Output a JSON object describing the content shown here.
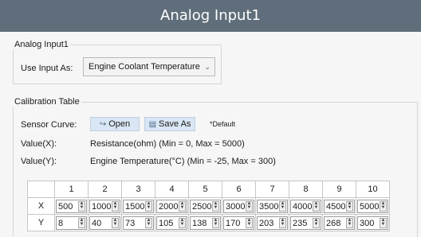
{
  "window": {
    "title": "Analog Input1"
  },
  "input_group": {
    "legend": "Analog Input1",
    "use_label": "Use Input As:",
    "use_value": "Engine Coolant Temperature"
  },
  "calibration": {
    "legend": "Calibration Table",
    "sensor_curve_label": "Sensor Curve:",
    "open_label": "Open",
    "save_label": "Save As",
    "default_note": "*Default",
    "value_x_label": "Value(X):",
    "value_x_text": "Resistance(ohm) (Min = 0, Max = 5000)",
    "value_y_label": "Value(Y):",
    "value_y_text": "Engine Temperature(°C) (Min = -25, Max = 300)",
    "columns": [
      "1",
      "2",
      "3",
      "4",
      "5",
      "6",
      "7",
      "8",
      "9",
      "10"
    ],
    "row_x_label": "X",
    "row_y_label": "Y",
    "x": [
      "500",
      "1000",
      "1500",
      "2000",
      "2500",
      "3000",
      "3500",
      "4000",
      "4500",
      "5000"
    ],
    "y": [
      "8",
      "40",
      "73",
      "105",
      "138",
      "170",
      "203",
      "235",
      "268",
      "300"
    ]
  },
  "icons": {
    "open": "open-arrow-icon",
    "save": "save-icon",
    "spin": "spin-arrows-icon",
    "dropdown": "chevron-down-icon"
  }
}
